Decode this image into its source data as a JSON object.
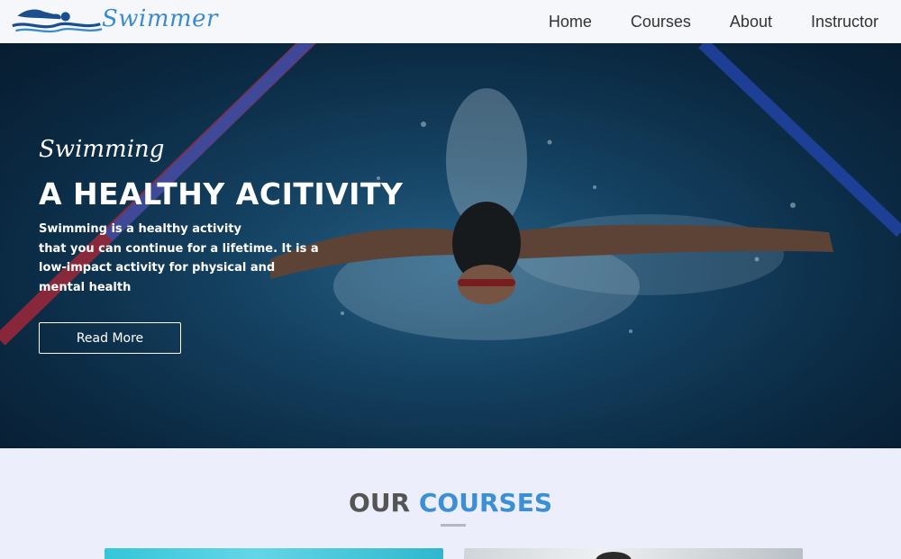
{
  "brand": {
    "name": "Swimmer",
    "logo_icon": "swimmer-logo-icon"
  },
  "nav": {
    "items": [
      "Home",
      "Courses",
      "About",
      "Instructor"
    ]
  },
  "hero": {
    "subtitle": "Swimming",
    "title": "A HEALTHY ACITIVITY",
    "text_lines": [
      "Swimming is a healthy activity",
      "that you can continue for a lifetime. It is a",
      "low-impact activity for physical and",
      "mental health"
    ],
    "button_label": "Read More"
  },
  "courses": {
    "title_part1": "OUR",
    "title_part2": "COURSES"
  },
  "colors": {
    "accent": "#3b8fd6",
    "header_bg": "#f6f7fa",
    "section_bg": "#eceefb"
  }
}
